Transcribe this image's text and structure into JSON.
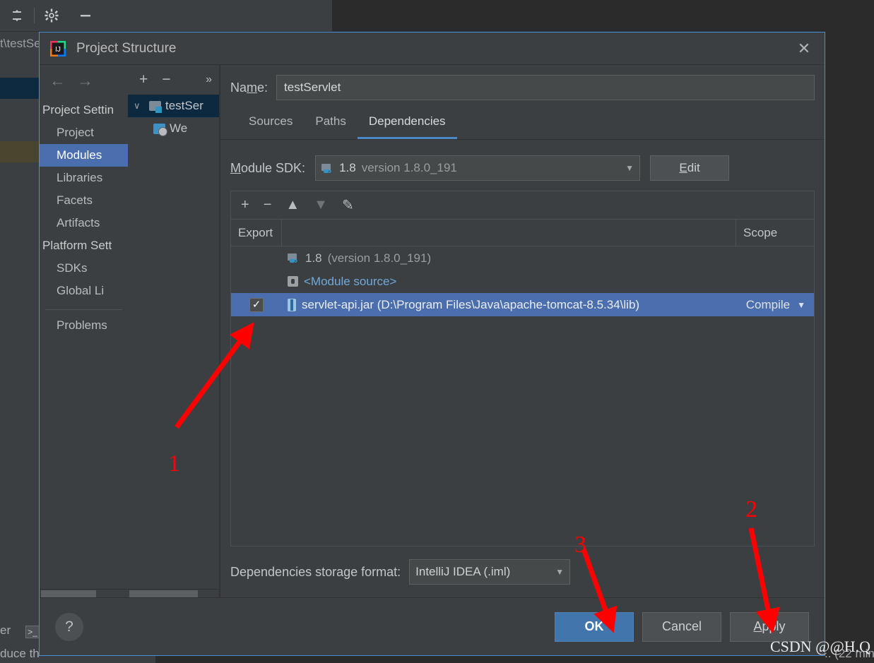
{
  "background": {
    "toolbar_icons": [
      "collapse-all-icon",
      "settings-gear-icon",
      "minimize-icon"
    ],
    "path_fragment": "t\\testSe",
    "left_bottom_lines": [
      "er",
      "duce th"
    ],
    "chip_label": ">_",
    "status_fragment": ".. (22 min"
  },
  "dialog": {
    "title": "Project Structure",
    "close_label": "✕",
    "nav": {
      "back_icon": "←",
      "forward_icon": "→",
      "groups": [
        {
          "label": "Project Settin",
          "items": [
            {
              "label": "Project",
              "active": false
            },
            {
              "label": "Modules",
              "active": true
            },
            {
              "label": "Libraries",
              "active": false
            },
            {
              "label": "Facets",
              "active": false
            },
            {
              "label": "Artifacts",
              "active": false
            }
          ]
        },
        {
          "label": "Platform Sett",
          "items": [
            {
              "label": "SDKs",
              "active": false
            },
            {
              "label": "Global Li",
              "active": false
            }
          ]
        }
      ],
      "footer_items": [
        {
          "label": "Problems",
          "active": false
        }
      ]
    },
    "tree": {
      "toolbar": {
        "add": "+",
        "remove": "−",
        "more": "»"
      },
      "rows": [
        {
          "label": "testSer",
          "icon": "module-folder-icon",
          "expanded": true,
          "selected": true,
          "indent": 0
        },
        {
          "label": "We",
          "icon": "web-facet-icon",
          "expanded": false,
          "selected": false,
          "indent": 1
        }
      ]
    },
    "name": {
      "label": "Na",
      "label_underline": "m",
      "label_tail": "e:",
      "value": "testServlet"
    },
    "tabs": [
      {
        "label": "Sources",
        "active": false
      },
      {
        "label": "Paths",
        "active": false
      },
      {
        "label": "Dependencies",
        "active": true
      }
    ],
    "module_sdk": {
      "label_head": "",
      "label_underline": "M",
      "label_tail": "odule SDK:",
      "value_name": "1.8",
      "value_version": "version 1.8.0_191",
      "edit_head": "",
      "edit_underline": "E",
      "edit_tail": "dit"
    },
    "dep_toolbar": {
      "add": "+",
      "remove": "−",
      "up": "▲",
      "down": "▼",
      "edit": "✎"
    },
    "table": {
      "headers": {
        "export": "Export",
        "middle": "",
        "scope": "Scope"
      },
      "rows": [
        {
          "checkbox": false,
          "icon": "jdk-icon",
          "name": "1.8",
          "name_suffix": "(version 1.8.0_191)",
          "scope": "",
          "selected": false,
          "style": "sdk"
        },
        {
          "checkbox": false,
          "icon": "module-source-icon",
          "name": "<Module source>",
          "name_suffix": "",
          "scope": "",
          "selected": false,
          "style": "link"
        },
        {
          "checkbox": true,
          "icon": "jar-icon",
          "name": "servlet-api.jar (D:\\Program Files\\Java\\apache-tomcat-8.5.34\\lib)",
          "name_suffix": "",
          "scope": "Compile",
          "selected": true,
          "style": "selected"
        }
      ]
    },
    "storage": {
      "label": "Dependencies storage format:",
      "value": "IntelliJ IDEA (.iml)"
    },
    "footer": {
      "help_label": "?",
      "ok": "OK",
      "cancel": "Cancel",
      "apply_head": "",
      "apply_underline": "A",
      "apply_tail": "pply"
    }
  },
  "annotations": {
    "numbers": [
      {
        "text": "1",
        "target": "export-checkbox"
      },
      {
        "text": "2",
        "target": "apply-button"
      },
      {
        "text": "3",
        "target": "ok-button"
      }
    ],
    "color": "#ff0000"
  },
  "watermark": {
    "text": "CSDN @@H.Q"
  },
  "colors": {
    "dialog_bg": "#3c3f41",
    "accent_blue": "#4b6eaf",
    "selection_blue": "#4b6eaf",
    "tab_underline": "#4a88c7",
    "link_blue": "#6fa8dc",
    "annotation_red": "#ff0000",
    "window_border": "#4a90d9"
  }
}
